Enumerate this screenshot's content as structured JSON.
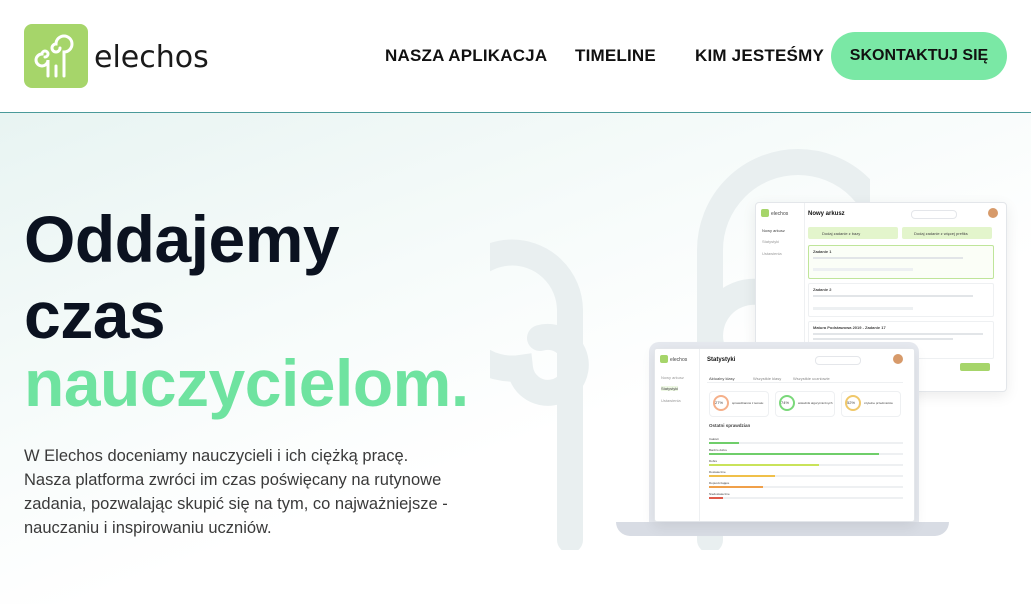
{
  "brand": {
    "name": "elechos",
    "accent": "#a6d56a",
    "cta_color": "#7ae8a5",
    "highlight": "#6fe3a0"
  },
  "nav": {
    "items": [
      "NASZA APLIKACJA",
      "TIMELINE",
      "KIM JESTEŚMY"
    ],
    "cta": "SKONTAKTUJ SIĘ"
  },
  "hero": {
    "line1": "Oddajemy",
    "line2": "czas",
    "line3": "nauczycielom.",
    "description": "W Elechos doceniamy nauczycieli i ich ciężką pracę. Nasza platforma zwróci im czas poświęcany na rutynowe zadania, pozwalając skupić się na tym, co najważniejsze - nauczaniu i inspirowaniu uczniów."
  },
  "mockup_back": {
    "logo": "elechos",
    "title": "Nowy arkusz",
    "sidebar": [
      "Nowy arkusz",
      "Statystyki",
      "Ustawienia"
    ],
    "buttons": [
      "Dodaj zadanie z bazy",
      "Dodaj zadanie z więcej prefiks"
    ],
    "task1_title": "Zadanie 1",
    "task2_title": "Zadanie 2",
    "task3_title": "Matura Podstawowa 2019 - Zadanie 17"
  },
  "mockup_front": {
    "logo": "elechos",
    "title": "Statystyki",
    "sidebar": [
      "Nowy arkusz",
      "Statystyki",
      "Ustawienia"
    ],
    "tabs": [
      "Aktualny klasy",
      "Wszystkie klasy",
      "Wszystkie uczniowie"
    ],
    "cards": [
      {
        "value": "27%",
        "text": "sprawdzianów z tematu"
      },
      {
        "value": "74%",
        "text": "wskaźnik algorytmicznych"
      },
      {
        "value": "52%",
        "text": "czytelne przedmiotów"
      }
    ],
    "section": "Ostatni sprawdzian",
    "rows": [
      "Całości",
      "Bardzo dobre",
      "Dobre",
      "Dostateczne",
      "Dopuszczające",
      "Niedostateczne"
    ]
  }
}
